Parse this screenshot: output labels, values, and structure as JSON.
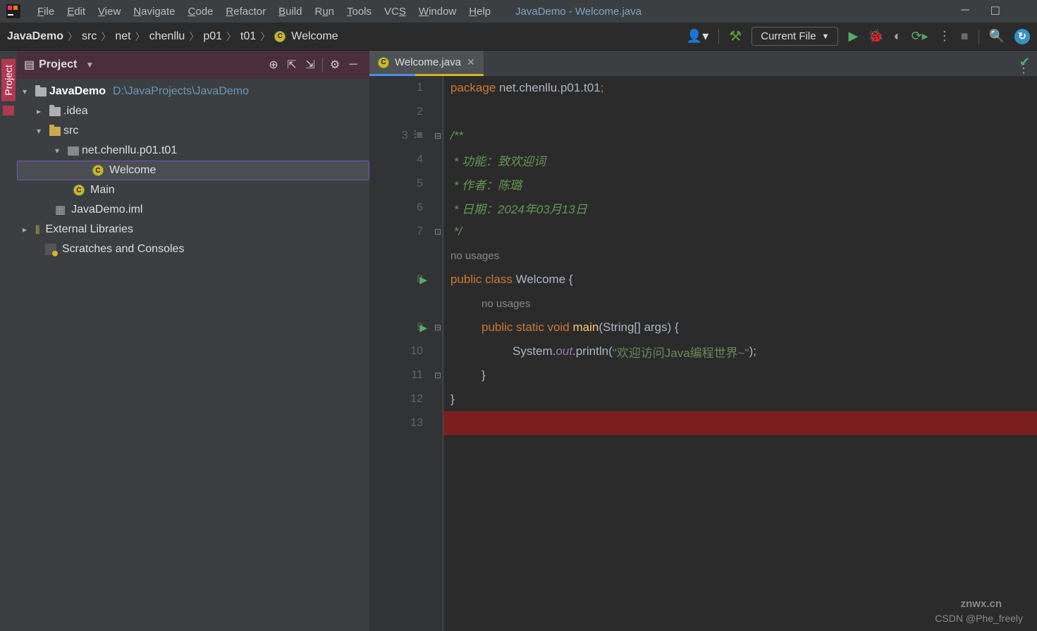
{
  "window_title": "JavaDemo - Welcome.java",
  "menu": [
    "File",
    "Edit",
    "View",
    "Navigate",
    "Code",
    "Refactor",
    "Build",
    "Run",
    "Tools",
    "VCS",
    "Window",
    "Help"
  ],
  "breadcrumb": [
    "JavaDemo",
    "src",
    "net",
    "chenllu",
    "p01",
    "t01",
    "Welcome"
  ],
  "run_config": "Current File",
  "project_panel_title": "Project",
  "tree": {
    "root": "JavaDemo",
    "root_path": "D:\\JavaProjects\\JavaDemo",
    "idea": ".idea",
    "src": "src",
    "pkg": "net.chenllu.p01.t01",
    "welcome": "Welcome",
    "main": "Main",
    "iml": "JavaDemo.iml",
    "ext": "External Libraries",
    "scratch": "Scratches and Consoles"
  },
  "tab_name": "Welcome.java",
  "no_usages": "no usages",
  "code": {
    "l1_kw": "package",
    "l1_rest": " net.chenllu.p01.t01",
    "l1_semi": ";",
    "l3": "/**",
    "l4": " * 功能：致欢迎词",
    "l5": " * 作者：陈璐",
    "l6": " * 日期：2024年03月13日",
    "l7": " */",
    "l8_kw1": "public ",
    "l8_kw2": "class ",
    "l8_name": "Welcome ",
    "l8_brace": "{",
    "l9_kw1": "public ",
    "l9_kw2": "static ",
    "l9_kw3": "void ",
    "l9_m": "main",
    "l9_sig": "(String[] args) {",
    "l10_pre": "System.",
    "l10_out": "out",
    "l10_call": ".println(",
    "l10_str": "\"欢迎访问Java编程世界~\"",
    "l10_end": ");",
    "l11": "}",
    "l12": "}"
  },
  "line_nums": [
    "1",
    "2",
    "3",
    "4",
    "5",
    "6",
    "7",
    "8",
    "9",
    "10",
    "11",
    "12",
    "13"
  ],
  "watermark": "CSDN @Phe_freely",
  "watermark2": "znwx.cn"
}
